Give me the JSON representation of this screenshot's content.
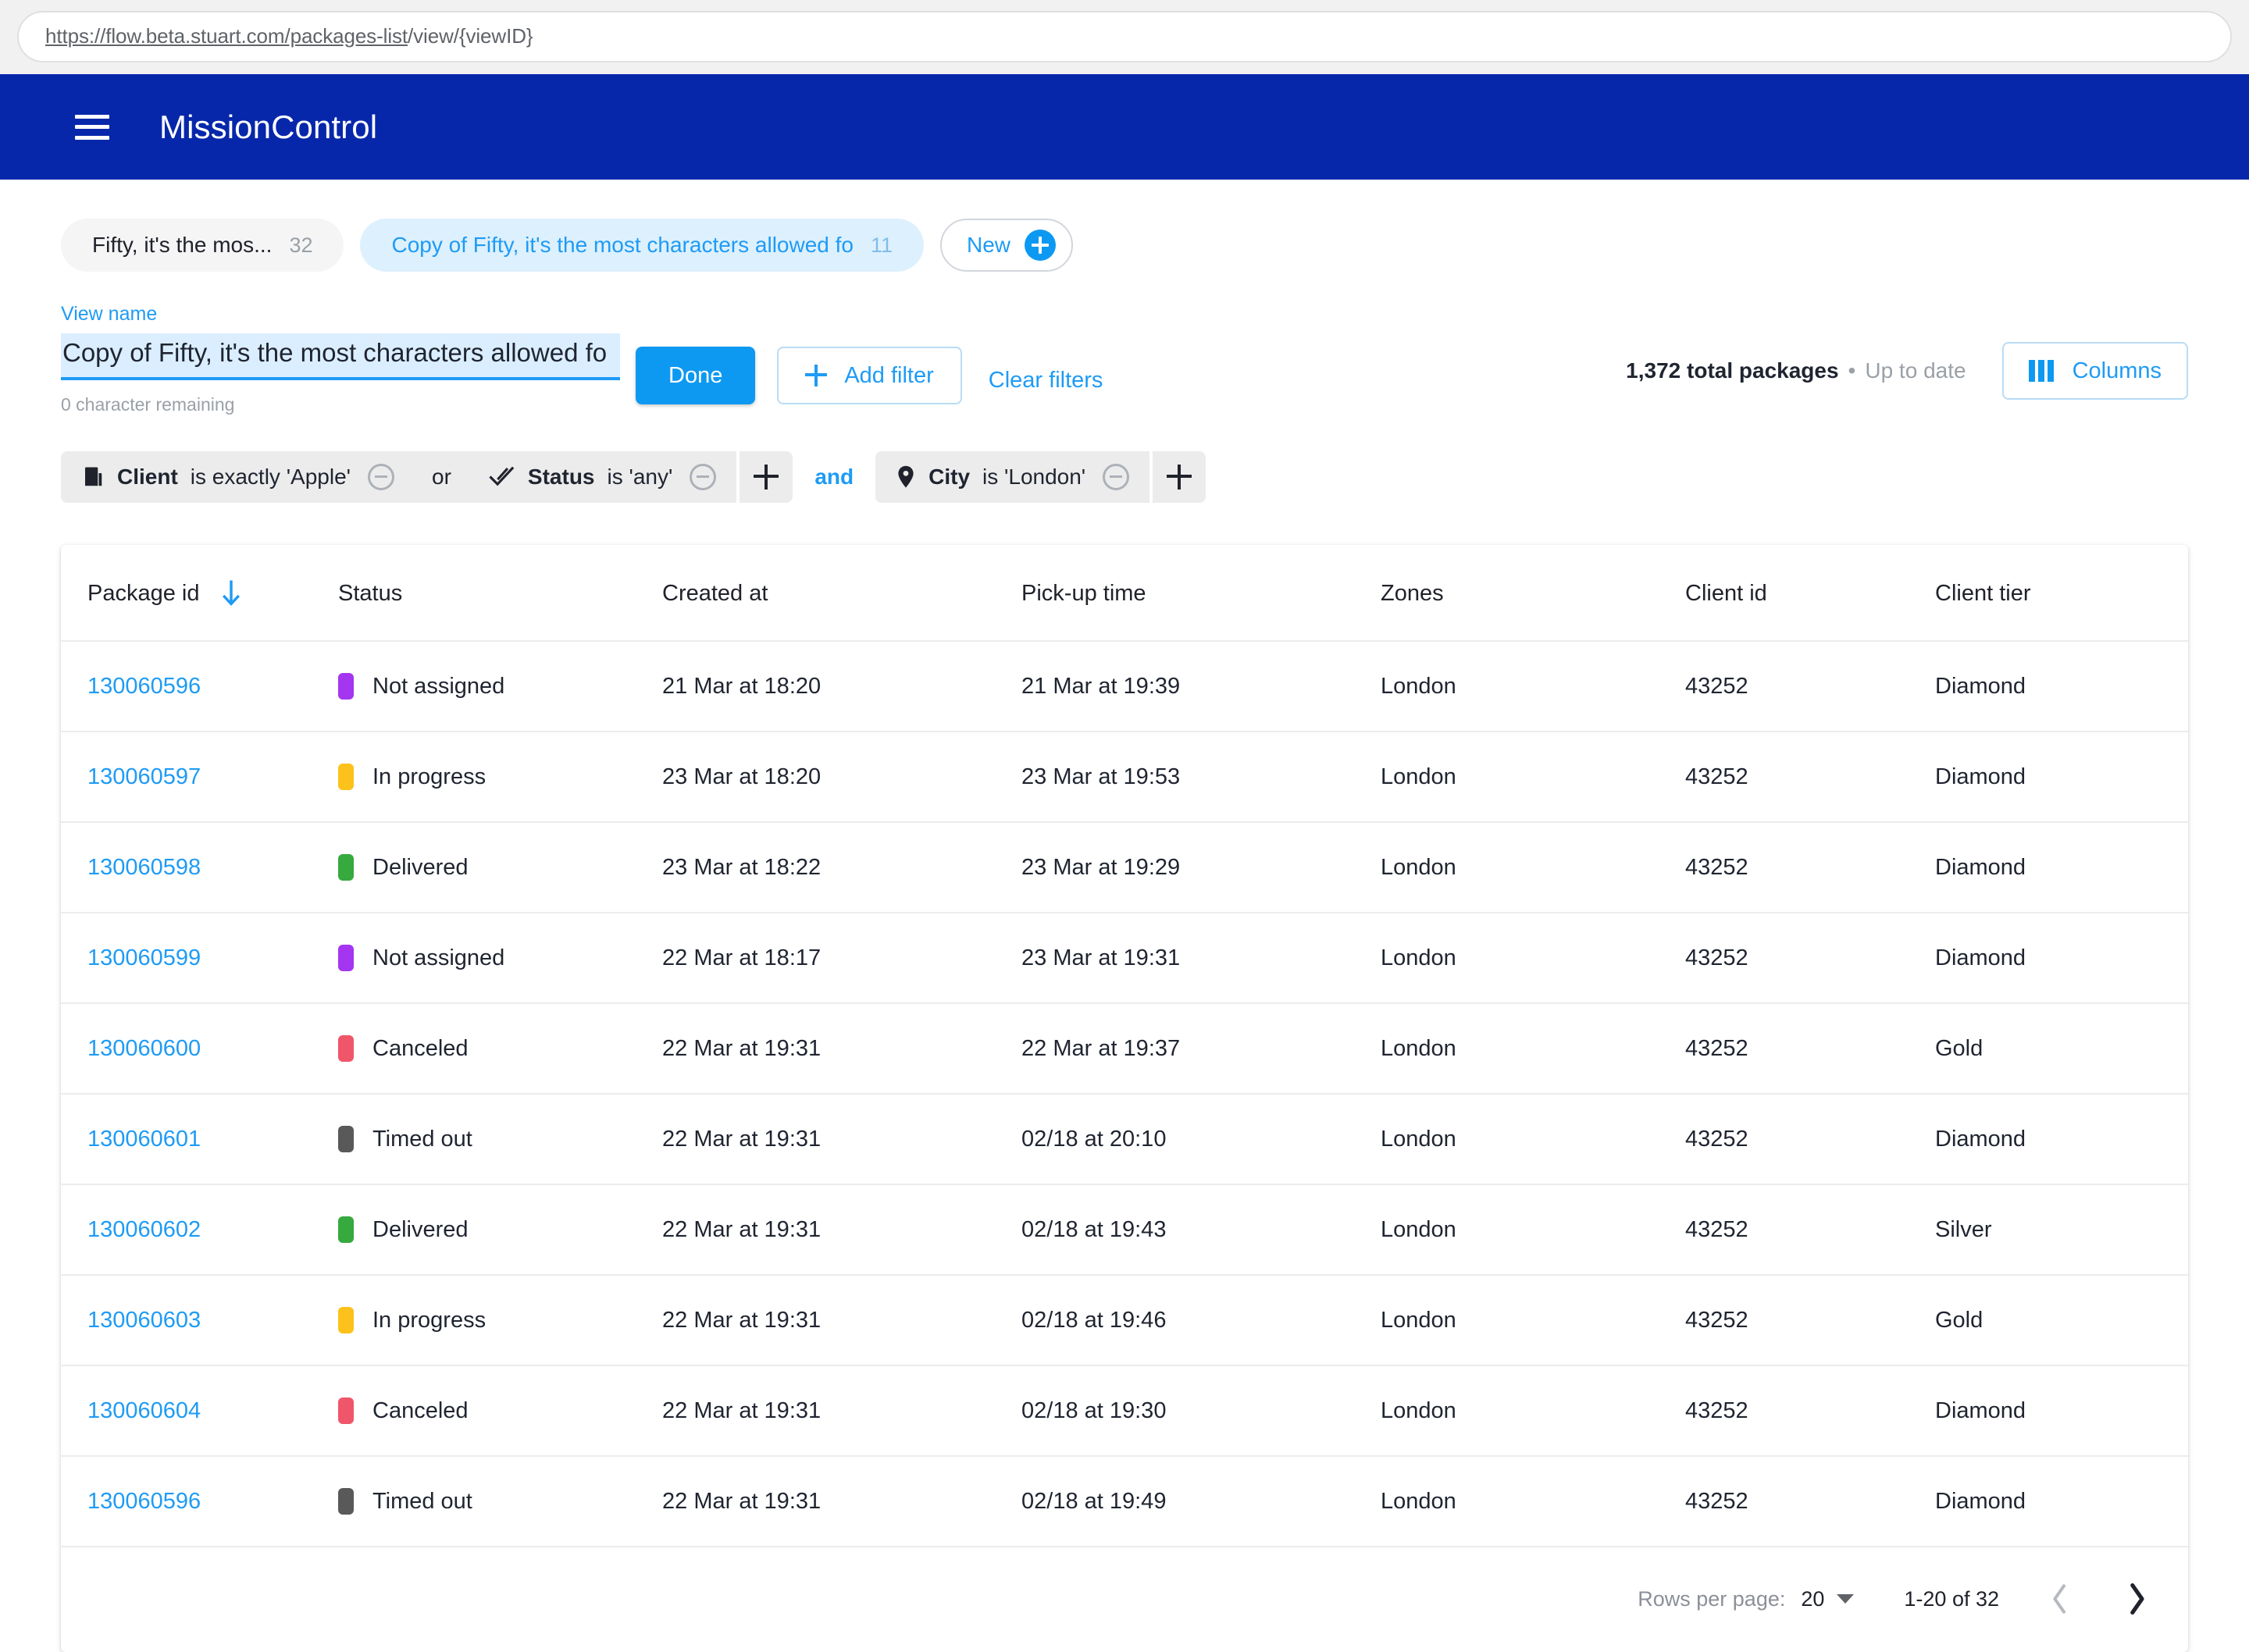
{
  "browser": {
    "url_scheme_host": "https://flow.beta.stuart.com/packages-list",
    "url_rest": "/view/{viewID}"
  },
  "appbar": {
    "menu_icon": "hamburger-menu-icon",
    "title": "MissionControl"
  },
  "tabs": [
    {
      "label": "Fifty, it's the mos...",
      "count": "32",
      "state": "inactive"
    },
    {
      "label": "Copy of Fifty, it's the most characters allowed fo",
      "count": "11",
      "state": "active"
    }
  ],
  "new_tab_button": {
    "label": "New",
    "icon": "plus-circle-icon"
  },
  "view_name": {
    "label": "View name",
    "value": "Copy of Fifty, it's the most characters allowed fo",
    "placeholder": "View name",
    "hint": "0 character remaining"
  },
  "toolbar": {
    "done_label": "Done",
    "add_filter_label": "Add filter",
    "add_filter_icon": "plus-icon",
    "clear_filters_label": "Clear filters",
    "total_packages": "1,372 total packages",
    "separator": "•",
    "sync_status": "Up to date",
    "columns_label": "Columns",
    "columns_icon": "columns-icon"
  },
  "filters": {
    "groups": [
      {
        "conditions": [
          {
            "icon": "building-icon",
            "field": "Client",
            "operator": "is exactly 'Apple'",
            "remove_icon": "minus-circle-icon"
          },
          {
            "joiner": "or",
            "icon": "check-icon",
            "field": "Status",
            "operator": "is 'any'",
            "remove_icon": "minus-circle-icon"
          }
        ],
        "add_icon": "plus-icon"
      },
      {
        "joiner": "and",
        "conditions": [
          {
            "icon": "location-pin-icon",
            "field": "City",
            "operator": "is 'London'",
            "remove_icon": "minus-circle-icon"
          }
        ],
        "add_icon": "plus-icon"
      }
    ]
  },
  "table": {
    "columns": [
      "Package id",
      "Status",
      "Created at",
      "Pick-up time",
      "Zones",
      "Client id",
      "Client tier"
    ],
    "sort": {
      "column": "Package id",
      "direction": "down",
      "icon": "arrow-down-icon"
    },
    "rows": [
      {
        "package_id": "130060596",
        "status": "Not assigned",
        "status_color": "#a435f0",
        "created_at": "21 Mar at 18:20",
        "pickup_time": "21 Mar at 19:39",
        "zones": "London",
        "client_id": "43252",
        "client_tier": "Diamond"
      },
      {
        "package_id": "130060597",
        "status": "In progress",
        "status_color": "#fcc21b",
        "created_at": "23 Mar at 18:20",
        "pickup_time": "23 Mar at 19:53",
        "zones": "London",
        "client_id": "43252",
        "client_tier": "Diamond"
      },
      {
        "package_id": "130060598",
        "status": "Delivered",
        "status_color": "#36a93f",
        "created_at": "23 Mar at 18:22",
        "pickup_time": "23 Mar at 19:29",
        "zones": "London",
        "client_id": "43252",
        "client_tier": "Diamond"
      },
      {
        "package_id": "130060599",
        "status": "Not assigned",
        "status_color": "#a435f0",
        "created_at": "22 Mar at 18:17",
        "pickup_time": "23 Mar at 19:31",
        "zones": "London",
        "client_id": "43252",
        "client_tier": "Diamond"
      },
      {
        "package_id": "130060600",
        "status": "Canceled",
        "status_color": "#f0566a",
        "created_at": "22 Mar at 19:31",
        "pickup_time": "22 Mar at 19:37",
        "zones": "London",
        "client_id": "43252",
        "client_tier": "Gold"
      },
      {
        "package_id": "130060601",
        "status": "Timed out",
        "status_color": "#595959",
        "created_at": "22 Mar at 19:31",
        "pickup_time": "02/18 at 20:10",
        "zones": "London",
        "client_id": "43252",
        "client_tier": "Diamond"
      },
      {
        "package_id": "130060602",
        "status": "Delivered",
        "status_color": "#36a93f",
        "created_at": "22 Mar at 19:31",
        "pickup_time": "02/18 at 19:43",
        "zones": "London",
        "client_id": "43252",
        "client_tier": "Silver"
      },
      {
        "package_id": "130060603",
        "status": "In progress",
        "status_color": "#fcc21b",
        "created_at": "22 Mar at 19:31",
        "pickup_time": "02/18 at 19:46",
        "zones": "London",
        "client_id": "43252",
        "client_tier": "Gold"
      },
      {
        "package_id": "130060604",
        "status": "Canceled",
        "status_color": "#f0566a",
        "created_at": "22 Mar at 19:31",
        "pickup_time": "02/18 at 19:30",
        "zones": "London",
        "client_id": "43252",
        "client_tier": "Diamond"
      },
      {
        "package_id": "130060596",
        "status": "Timed out",
        "status_color": "#595959",
        "created_at": "22 Mar at 19:31",
        "pickup_time": "02/18 at 19:49",
        "zones": "London",
        "client_id": "43252",
        "client_tier": "Diamond"
      }
    ]
  },
  "pagination": {
    "rows_per_page_label": "Rows per page:",
    "rows_per_page_value": "20",
    "range_label": "1-20 of 32",
    "prev_icon": "chevron-left-icon",
    "next_icon": "chevron-right-icon"
  },
  "colors": {
    "brand_blue": "#0727ab",
    "accent_blue": "#1e9bf5",
    "active_tab_bg": "#ddf0fd"
  }
}
